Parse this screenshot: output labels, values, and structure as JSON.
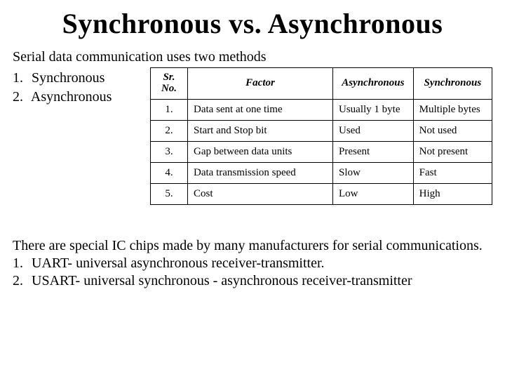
{
  "title": "Synchronous vs. Asynchronous",
  "intro": "Serial data communication uses two methods",
  "methods": [
    {
      "num": "1.",
      "name": "Synchronous"
    },
    {
      "num": "2.",
      "name": "Asynchronous"
    }
  ],
  "table": {
    "headers": {
      "sr": "Sr.\nNo.",
      "factor": "Factor",
      "async": "Asynchronous",
      "sync": "Synchronous"
    },
    "rows": [
      {
        "sr": "1.",
        "factor": "Data sent at one time",
        "async": "Usually 1 byte",
        "sync": "Multiple bytes"
      },
      {
        "sr": "2.",
        "factor": "Start and Stop bit",
        "async": "Used",
        "sync": "Not used"
      },
      {
        "sr": "3.",
        "factor": "Gap between data units",
        "async": "Present",
        "sync": "Not present"
      },
      {
        "sr": "4.",
        "factor": "Data transmission speed",
        "async": "Slow",
        "sync": "Fast"
      },
      {
        "sr": "5.",
        "factor": "Cost",
        "async": "Low",
        "sync": "High"
      }
    ]
  },
  "outro_intro": "There are special IC chips made by many manufacturers for serial communications.",
  "outro_items": [
    {
      "num": "1.",
      "text": "UART- universal asynchronous receiver-transmitter."
    },
    {
      "num": "2.",
      "text": "USART- universal synchronous - asynchronous receiver-transmitter"
    }
  ]
}
